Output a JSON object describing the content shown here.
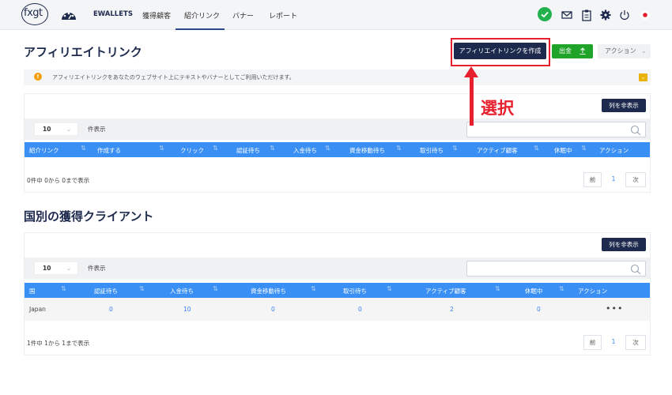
{
  "nav": {
    "logo": "fxgt",
    "items": [
      "EWALLETS",
      "獲得顧客",
      "紹介リンク",
      "バナー",
      "レポート"
    ]
  },
  "page": {
    "title": "アフィリエイトリンク",
    "create_button": "アフィリエイトリンクを作成",
    "withdraw_button": "出金",
    "action_button": "アクション",
    "notice": "アフィリエイトリンクをあなたのウェブサイト上にテキストやバナーとしてご利用いただけます。",
    "annotation": "選択"
  },
  "links_table": {
    "columns_button": "列を非表示",
    "entries_value": "10",
    "entries_label": "件表示",
    "headers": [
      "紹介リンク",
      "作成する",
      "クリック",
      "認証待ち",
      "入金待ち",
      "資金移動待ち",
      "取引待ち",
      "アクティブ顧客",
      "休眠中",
      "アクション"
    ],
    "info": "0件中 0から 0まで表示",
    "prev": "前",
    "page": "1",
    "next": "次"
  },
  "country": {
    "title": "国別の獲得クライアント",
    "columns_button": "列を非表示",
    "entries_value": "10",
    "entries_label": "件表示",
    "headers": [
      "国",
      "認証待ち",
      "入金待ち",
      "資金移動待ち",
      "取引待ち",
      "アクティブ顧客",
      "休眠中",
      "アクション"
    ],
    "row": {
      "country": "Japan",
      "verify": "0",
      "deposit": "10",
      "transfer": "0",
      "trade": "0",
      "active": "2",
      "dormant": "0",
      "action": "•••"
    },
    "info": "1件中 1から 1まで表示",
    "prev": "前",
    "page": "1",
    "next": "次"
  },
  "colors": {
    "primary": "#1d2a4d",
    "table_header": "#3a8ff5",
    "success": "#1fa329",
    "annotation": "#e6202c"
  }
}
